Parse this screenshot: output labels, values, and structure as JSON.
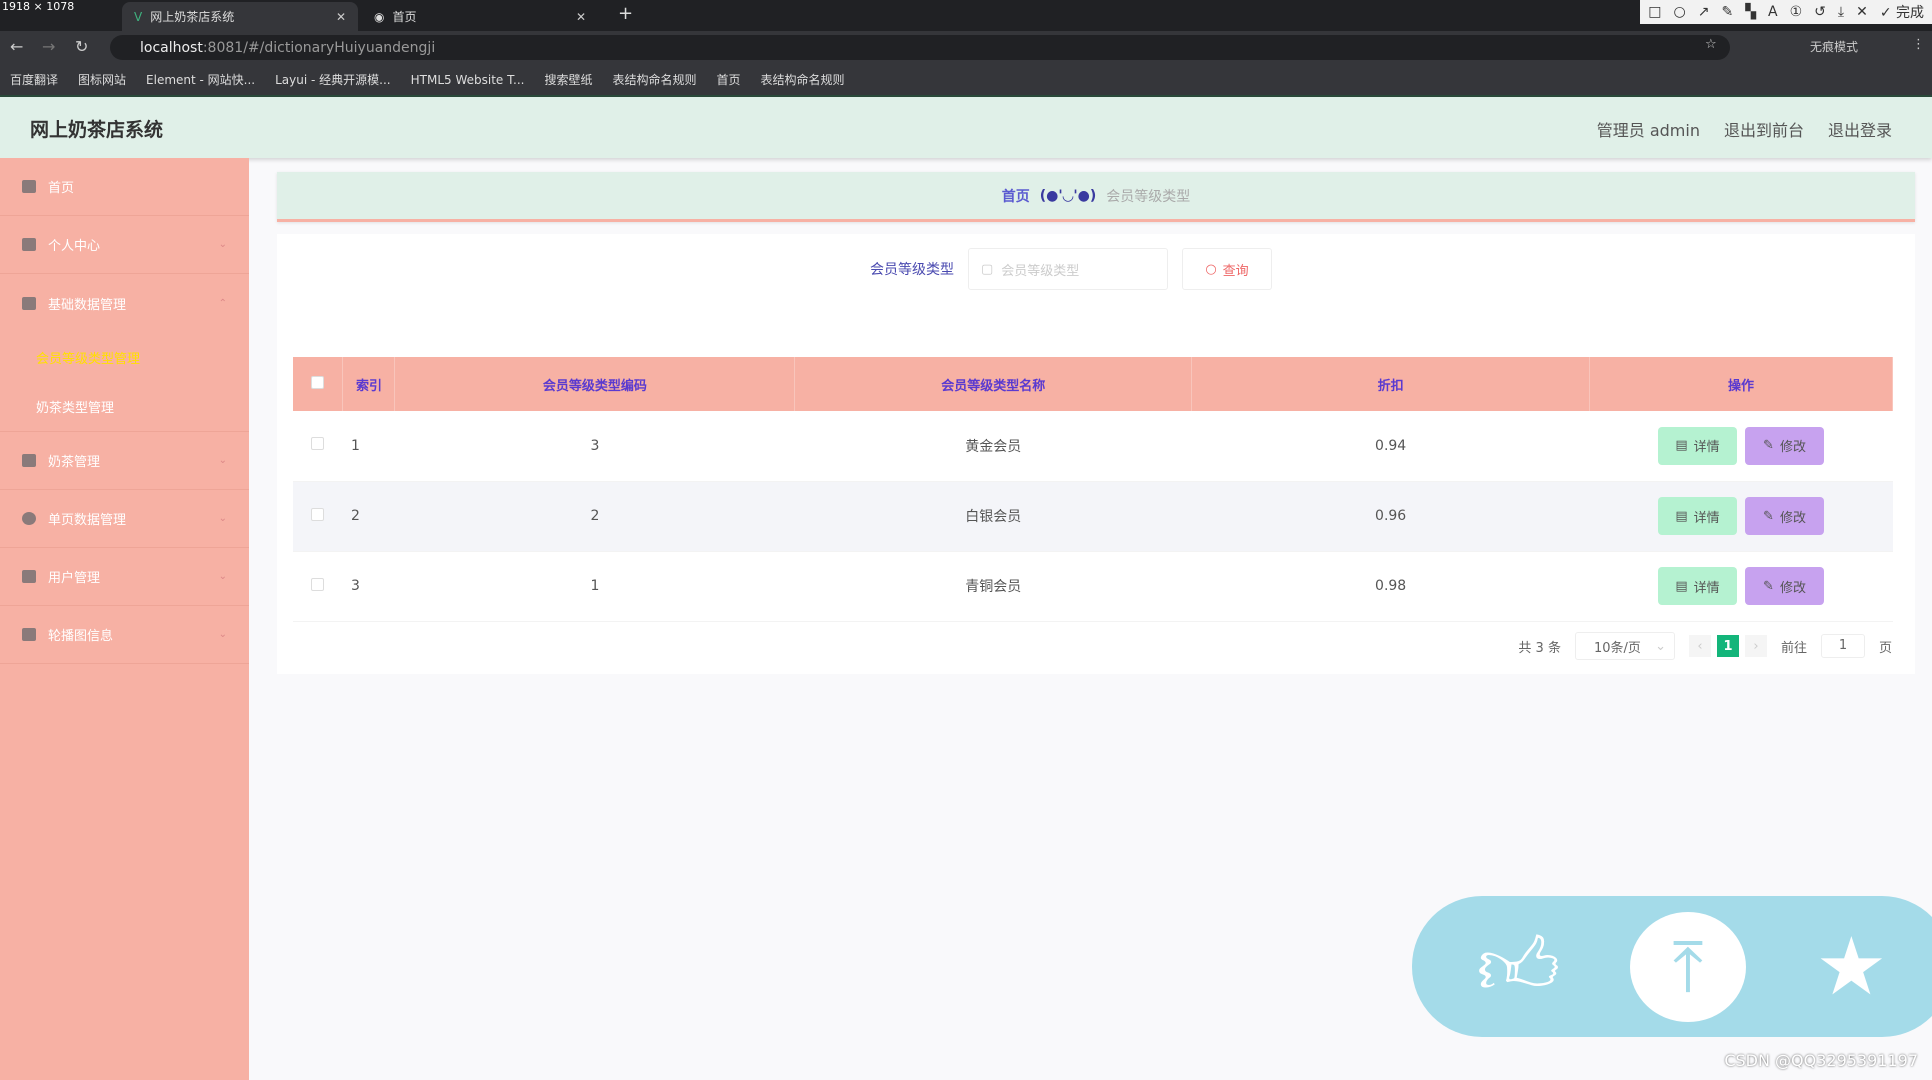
{
  "browser": {
    "size_badge": "1918 × 1078",
    "tabs": [
      {
        "label": "网上奶茶店系统",
        "active": true
      },
      {
        "label": "首页",
        "active": false
      }
    ],
    "url_host": "localhost",
    "url_rest": ":8081/#/dictionaryHuiyuandengji",
    "incognito": "无痕模式",
    "screenshot_done": "完成",
    "bookmarks": [
      "百度翻译",
      "图标网站",
      "Element - 网站快...",
      "Layui - 经典开源模...",
      "HTML5 Website T...",
      "搜索壁纸",
      "表结构命名规则",
      "首页",
      "表结构命名规则"
    ]
  },
  "header": {
    "title": "网上奶茶店系统",
    "user": "管理员 admin",
    "to_front": "退出到前台",
    "logout": "退出登录"
  },
  "sidebar": {
    "items": [
      {
        "label": "首页",
        "icon": "home-icon"
      },
      {
        "label": "个人中心",
        "icon": "user-icon"
      },
      {
        "label": "基础数据管理",
        "icon": "mail-icon"
      },
      {
        "label": "奶茶管理",
        "icon": "box-icon"
      },
      {
        "label": "单页数据管理",
        "icon": "compass-icon"
      },
      {
        "label": "用户管理",
        "icon": "clipboard-icon"
      },
      {
        "label": "轮播图信息",
        "icon": "image-icon"
      }
    ],
    "subitems": [
      {
        "label": "会员等级类型管理",
        "active": true
      },
      {
        "label": "奶茶类型管理",
        "active": false
      }
    ]
  },
  "breadcrumb": {
    "home": "首页",
    "separator": "(●'◡'●)",
    "current": "会员等级类型"
  },
  "search": {
    "label": "会员等级类型",
    "placeholder": "会员等级类型",
    "button": "查询"
  },
  "table": {
    "headers": [
      "索引",
      "会员等级类型编码",
      "会员等级类型名称",
      "折扣",
      "操作"
    ],
    "rows": [
      {
        "index": "1",
        "code": "3",
        "name": "黄金会员",
        "discount": "0.94"
      },
      {
        "index": "2",
        "code": "2",
        "name": "白银会员",
        "discount": "0.96"
      },
      {
        "index": "3",
        "code": "1",
        "name": "青铜会员",
        "discount": "0.98"
      }
    ],
    "detail_label": "详情",
    "edit_label": "修改"
  },
  "pagination": {
    "total": "共 3 条",
    "page_size": "10条/页",
    "current": "1",
    "goto_prefix": "前往",
    "goto_value": "1",
    "goto_suffix": "页"
  },
  "watermark": "CSDN @QQ3295391197",
  "colors": {
    "sidebar": "#f7b1a4",
    "header": "#e0f0e8",
    "detail_btn": "#b5f2d1",
    "edit_btn": "#c7a2ef",
    "float_widget": "#a4dbe9",
    "active_page": "#13b57a"
  }
}
